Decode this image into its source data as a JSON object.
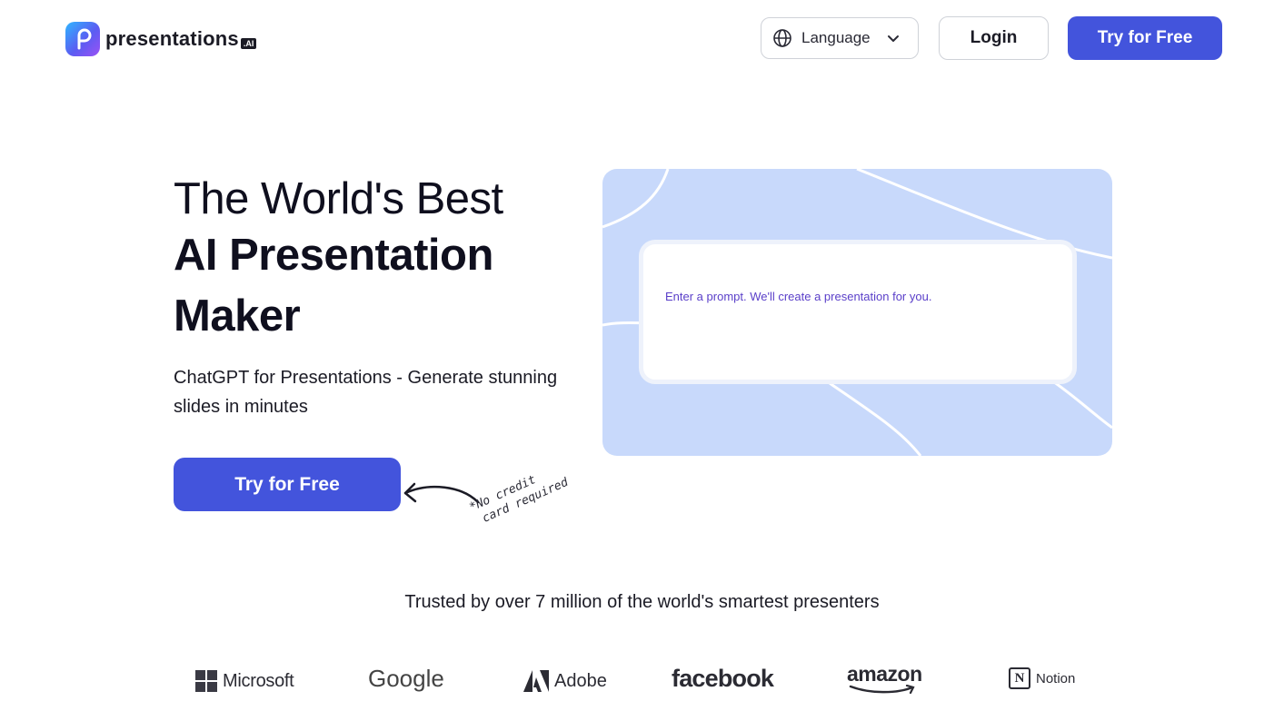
{
  "header": {
    "logo_text": "presentations",
    "logo_badge": ".AI",
    "language_label": "Language",
    "login_label": "Login",
    "try_label": "Try for Free"
  },
  "hero": {
    "title_line1": "The World's Best",
    "title_line2": "AI Presentation",
    "title_line3": "Maker",
    "subtitle": "ChatGPT for Presentations - Generate stunning slides in minutes",
    "cta_label": "Try for Free",
    "note_line1": "*No credit",
    "note_line2": "card required"
  },
  "prompt": {
    "placeholder": "Enter a prompt. We'll create a presentation for you."
  },
  "trusted": {
    "text": "Trusted by over 7 million of the world's smartest presenters"
  },
  "brands": [
    "Microsoft",
    "Google",
    "Adobe",
    "facebook",
    "amazon",
    "Notion"
  ],
  "icons": {
    "globe": "globe-icon",
    "chevron": "chevron-down-icon",
    "arrow": "curved-arrow-icon"
  },
  "colors": {
    "primary": "#4354dc",
    "card_bg": "#c8d9fb",
    "prompt_text": "#5a3fc9"
  }
}
